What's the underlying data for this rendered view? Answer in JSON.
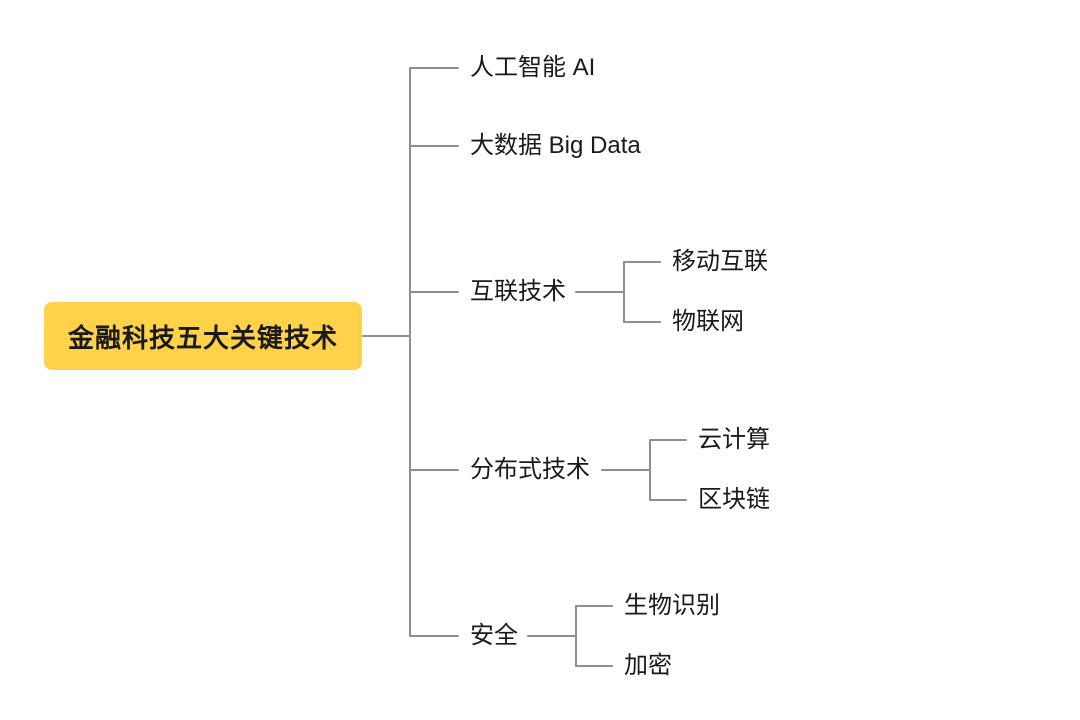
{
  "mindmap": {
    "root": {
      "label": "金融科技五大关键技术"
    },
    "branches": [
      {
        "label": "人工智能 AI",
        "children": []
      },
      {
        "label": "大数据 Big Data",
        "children": []
      },
      {
        "label": "互联技术",
        "children": [
          {
            "label": "移动互联"
          },
          {
            "label": "物联网"
          }
        ]
      },
      {
        "label": "分布式技术",
        "children": [
          {
            "label": "云计算"
          },
          {
            "label": "区块链"
          }
        ]
      },
      {
        "label": "安全",
        "children": [
          {
            "label": "生物识别"
          },
          {
            "label": "加密"
          }
        ]
      }
    ]
  },
  "colors": {
    "root_bg": "#ffd24a",
    "connector": "#8f8f8f",
    "text": "#1a1a1a"
  }
}
